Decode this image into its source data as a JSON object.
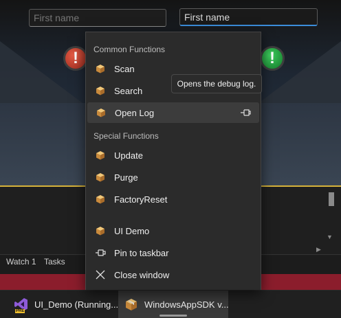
{
  "app": {
    "first_name_field_1": {
      "placeholder": "First name"
    },
    "first_name_field_2": {
      "value": "First name"
    },
    "bottom_tabs": [
      "Watch 1",
      "Tasks"
    ]
  },
  "jump_list": {
    "sections": [
      {
        "header": "Common Functions",
        "items": [
          {
            "label": "Scan",
            "icon": "package-icon"
          },
          {
            "label": "Search",
            "icon": "package-icon"
          },
          {
            "label": "Open Log",
            "icon": "package-icon",
            "pinnable": true,
            "highlighted": true
          }
        ]
      },
      {
        "header": "Special Functions",
        "items": [
          {
            "label": "Update",
            "icon": "package-icon"
          },
          {
            "label": "Purge",
            "icon": "package-icon"
          },
          {
            "label": "FactoryReset",
            "icon": "package-icon"
          }
        ]
      }
    ],
    "app_items": [
      {
        "label": "UI Demo",
        "icon": "package-icon"
      },
      {
        "label": "Pin to taskbar",
        "icon": "pin-icon"
      },
      {
        "label": "Close window",
        "icon": "close-icon"
      }
    ],
    "tooltip": "Opens the debug log."
  },
  "taskbar": {
    "items": [
      {
        "label": "UI_Demo (Running...",
        "icon": "visual-studio-preview-icon",
        "badge": "PRE"
      },
      {
        "label": "WindowsAppSDK v...",
        "icon": "package-icon",
        "active": true
      }
    ]
  },
  "colors": {
    "accent": "#3b8ddb",
    "gold": "#d7b33a",
    "status_red": "#c0392b",
    "status_green": "#1fa33d",
    "band_red": "#8b1d2c"
  }
}
